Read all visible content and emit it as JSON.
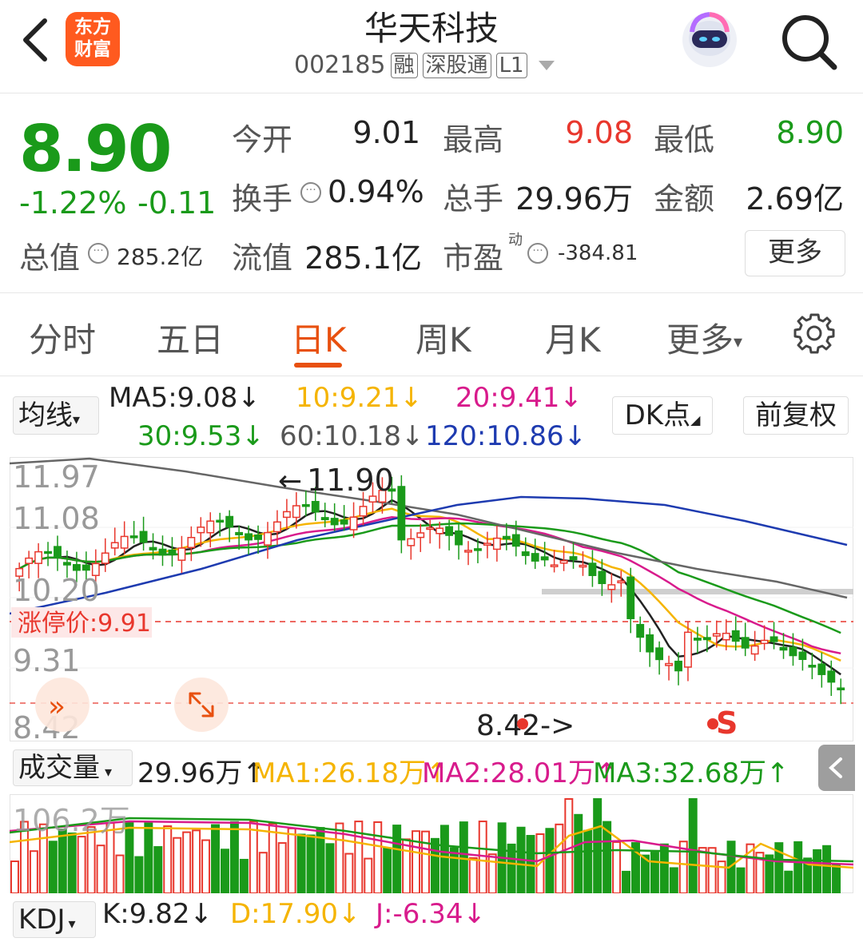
{
  "header": {
    "title": "华天科技",
    "code": "002185",
    "tags": [
      "融",
      "深股通",
      "L1"
    ],
    "logo_text": "东方财富"
  },
  "quote": {
    "price": "8.90",
    "change_pct": "-1.22%",
    "change_abs": "-0.11",
    "open_label": "今开",
    "open_value": "9.01",
    "high_label": "最高",
    "high_value": "9.08",
    "low_label": "最低",
    "low_value": "8.90",
    "turnover_label": "换手",
    "turnover_value": "0.94%",
    "volume_label": "总手",
    "volume_value": "29.96万",
    "amount_label": "金额",
    "amount_value": "2.69亿",
    "mktcap_label": "总值",
    "mktcap_value": "285.2亿",
    "float_label": "流值",
    "float_value": "285.1亿",
    "pe_label": "市盈",
    "pe_sup": "动",
    "pe_value": "-384.81",
    "more_label": "更多"
  },
  "tabs": [
    "分时",
    "五日",
    "日K",
    "周K",
    "月K",
    "更多"
  ],
  "active_tab": "日K",
  "ma_bar": {
    "selector": "均线",
    "ma5": "MA5:9.08↓",
    "ma10": "10:9.21↓",
    "ma20": "20:9.41↓",
    "ma30": "30:9.53↓",
    "ma60": "60:10.18↓",
    "ma120": "120:10.86↓",
    "dk_label": "DK点",
    "adjust_label": "前复权"
  },
  "kline": {
    "y_labels": [
      "11.97",
      "11.08",
      "10.20",
      "9.31",
      "8.42"
    ],
    "limit_label": "涨停价:9.91",
    "high_mark": "11.90",
    "low_mark": "8.42->",
    "signal": "S"
  },
  "volume_bar": {
    "selector": "成交量",
    "vol": "29.96万↑",
    "ma1": "MA1:26.18万↑",
    "ma2": "MA2:28.01万↑",
    "ma3": "MA3:32.68万↑",
    "max_label": "106.2万"
  },
  "kdj_bar": {
    "selector": "KDJ",
    "k": "K:9.82↓",
    "d": "D:17.90↓",
    "j": "J:-6.34↓"
  },
  "colors": {
    "up": "#e8372d",
    "down": "#1a9a1a",
    "accent": "#e8500f",
    "ma5": "#222222",
    "ma10": "#f5b400",
    "ma20": "#d81b8c",
    "ma30": "#1a9a1a",
    "ma60": "#666666",
    "ma120": "#1e3bb0"
  }
}
